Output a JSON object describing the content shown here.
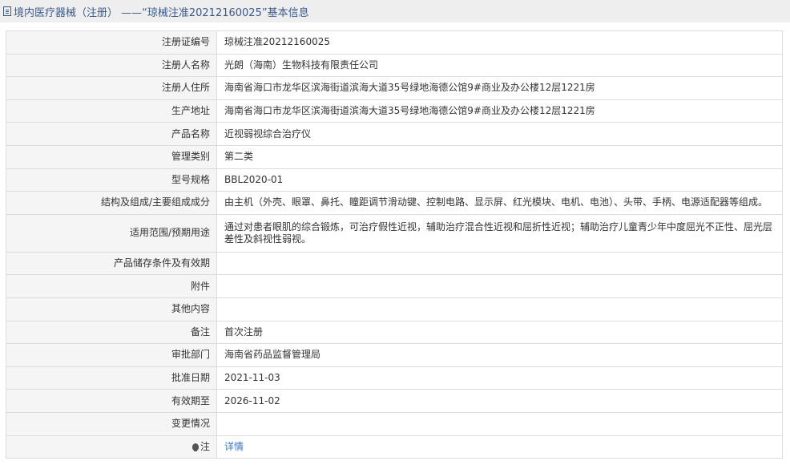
{
  "header": {
    "title": "境内医疗器械（注册） ——“琼械注准20212160025”基本信息"
  },
  "rows": [
    {
      "label": "注册证编号",
      "value": "琼械注准20212160025"
    },
    {
      "label": "注册人名称",
      "value": "光朗（海南）生物科技有限责任公司"
    },
    {
      "label": "注册人住所",
      "value": "海南省海口市龙华区滨海街道滨海大道35号绿地海德公馆9#商业及办公楼12层1221房"
    },
    {
      "label": "生产地址",
      "value": "海南省海口市龙华区滨海街道滨海大道35号绿地海德公馆9#商业及办公楼12层1221房"
    },
    {
      "label": "产品名称",
      "value": "近视弱视综合治疗仪"
    },
    {
      "label": "管理类别",
      "value": "第二类"
    },
    {
      "label": "型号规格",
      "value": "BBL2020-01"
    },
    {
      "label": "结构及组成/主要组成成分",
      "value": "由主机（外壳、眼罩、鼻托、瞳距调节滑动键、控制电路、显示屏、红光模块、电机、电池）、头带、手柄、电源适配器等组成。"
    },
    {
      "label": "适用范围/预期用途",
      "value": "通过对患者眼肌的综合锻炼，可治疗假性近视，辅助治疗混合性近视和屈折性近视；辅助治疗儿童青少年中度屈光不正性、屈光层差性及斜视性弱视。"
    },
    {
      "label": "产品储存条件及有效期",
      "value": ""
    },
    {
      "label": "附件",
      "value": ""
    },
    {
      "label": "其他内容",
      "value": ""
    },
    {
      "label": "备注",
      "value": "首次注册"
    },
    {
      "label": "审批部门",
      "value": "海南省药品监督管理局"
    },
    {
      "label": "批准日期",
      "value": "2021-11-03"
    },
    {
      "label": "有效期至",
      "value": "2026-11-02"
    },
    {
      "label": "变更情况",
      "value": ""
    }
  ],
  "note": {
    "label": "注",
    "link": "详情",
    "icon": "lightbulb-icon"
  },
  "colors": {
    "title": "#3a5b8a",
    "link": "#3a76c4",
    "label_bg": "#f5f5f5",
    "border": "#dcdcdc"
  }
}
